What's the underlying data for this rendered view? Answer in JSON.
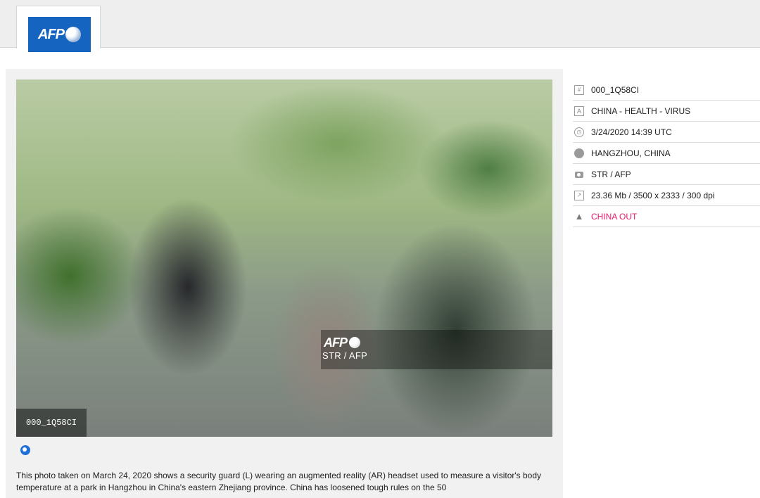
{
  "header": {
    "logo_text": "AFP",
    "logo_color": "#1565c0"
  },
  "photo": {
    "watermark_logo": "AFP",
    "watermark_credit": "STR / AFP",
    "id_overlay": "000_1Q58CI"
  },
  "meta": {
    "items": [
      {
        "icon": "document-icon",
        "text": "000_1Q58CI"
      },
      {
        "icon": "title-icon",
        "text": "CHINA - HEALTH - VIRUS"
      },
      {
        "icon": "clock-icon",
        "text": "3/24/2020 14:39 UTC"
      },
      {
        "icon": "globe-icon",
        "text": "HANGZHOU, CHINA"
      },
      {
        "icon": "camera-icon",
        "text": "STR / AFP"
      },
      {
        "icon": "resize-icon",
        "text": "23.36 Mb / 3500 x 2333 / 300 dpi"
      },
      {
        "icon": "warning-icon",
        "text": "CHINA OUT",
        "color": "#e8196b"
      }
    ]
  },
  "caption": "This photo taken on March 24, 2020 shows a security guard (L) wearing an augmented reality (AR) headset used to measure a visitor's body temperature at a park in Hangzhou in China's eastern Zhejiang province. China has loosened tough rules on the 50"
}
